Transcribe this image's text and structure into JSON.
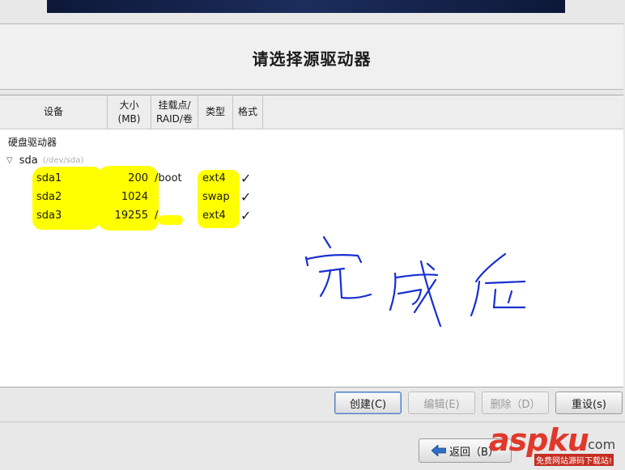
{
  "page_title": "请选择源驱动器",
  "table": {
    "headers": {
      "device": "设备",
      "size": "大小\n(MB)",
      "mount": "挂载点/\nRAID/卷",
      "type": "类型",
      "format": "格式"
    },
    "root_label": "硬盘驱动器",
    "disk": {
      "name": "sda",
      "path": "(/dev/sda)"
    },
    "partitions": [
      {
        "device": "sda1",
        "size": "200",
        "mount": "/boot",
        "type": "ext4",
        "format": "✓"
      },
      {
        "device": "sda2",
        "size": "1024",
        "mount": "",
        "type": "swap",
        "format": "✓"
      },
      {
        "device": "sda3",
        "size": "19255",
        "mount": "/",
        "type": "ext4",
        "format": "✓"
      }
    ]
  },
  "buttons": {
    "create": "创建(C)",
    "edit": "编辑(E)",
    "delete": "删除（D）",
    "reset": "重设(s)",
    "back": "返回（B）"
  },
  "watermark": {
    "brand": "aspku",
    "dot": ".",
    "com": "com",
    "sub": "免费网站源码下载站!"
  },
  "colors": {
    "highlight": "#ffff00",
    "scribble": "#1a2fd1",
    "watermark": "#e0392b"
  }
}
